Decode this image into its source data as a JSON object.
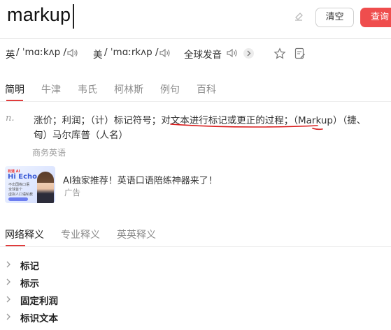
{
  "search": {
    "query": "markup",
    "clear_label": "清空",
    "search_label": "查询"
  },
  "pronunciation": {
    "uk_label": "英",
    "uk_phonetic": "/ ˈmɑːkʌp /",
    "us_label": "美",
    "us_phonetic": "/ ˈmɑːrkʌp /",
    "global_label": "全球发音"
  },
  "dict_tabs": [
    "简明",
    "牛津",
    "韦氏",
    "柯林斯",
    "例句",
    "百科"
  ],
  "definition": {
    "pos": "n.",
    "line1": "涨价；利润；（计）标记符号；对文本进行标记或更正的过程；（Markup）（捷、",
    "line2": "匈）马尔库普（人名）",
    "source": "商务英语"
  },
  "ad": {
    "brand": "有道 AI",
    "headline": "Hi Echo",
    "sub1": "不出国练口语",
    "sub2": "全球首个",
    "sub3": "虚拟人口语私教",
    "title": "AI独家推荐！英语口语陪练神器来了！",
    "tag": "广告"
  },
  "lower_tabs": [
    "网络释义",
    "专业释义",
    "英英释义"
  ],
  "senses": [
    "标记",
    "标示",
    "固定利润",
    "标识文本"
  ],
  "colors": {
    "accent": "#ef4d4d",
    "tab_underline": "#e03c3c",
    "scribble": "#d91c1c"
  }
}
